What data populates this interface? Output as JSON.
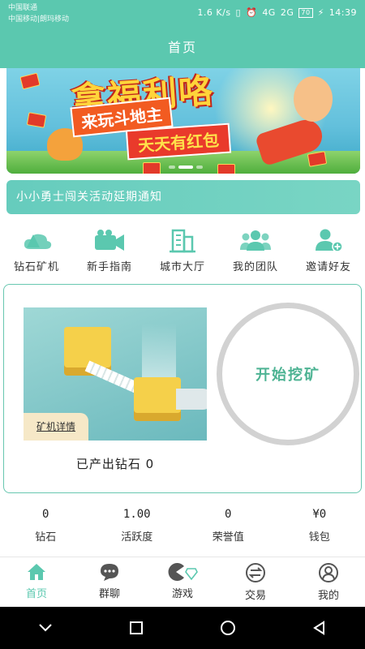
{
  "status_bar": {
    "carrier_line1": "中国联通",
    "carrier_line2": "中国移动|朗玛移动",
    "speed": "1.6 K/s",
    "signal1": "4G",
    "signal2": "2G",
    "battery": "70",
    "time": "14:39"
  },
  "header": {
    "title": "首页"
  },
  "banner": {
    "headline": "拿福利咯",
    "tag1": "来玩斗地主",
    "tag2": "天天有红包",
    "active_slide": 2,
    "slide_count": 3
  },
  "notice": {
    "text": "小小勇士闯关活动延期通知"
  },
  "menu": [
    {
      "label": "钻石矿机",
      "icon": "cloud-icon"
    },
    {
      "label": "新手指南",
      "icon": "video-camera-icon"
    },
    {
      "label": "城市大厅",
      "icon": "building-icon"
    },
    {
      "label": "我的团队",
      "icon": "team-icon"
    },
    {
      "label": "邀请好友",
      "icon": "add-user-icon"
    }
  ],
  "mining": {
    "detail_label": "矿机详情",
    "produced_label": "已产出钻石",
    "produced_value": "0",
    "start_label": "开始挖矿"
  },
  "stats": [
    {
      "value": "0",
      "label": "钻石"
    },
    {
      "value": "1.00",
      "label": "活跃度"
    },
    {
      "value": "0",
      "label": "荣誉值"
    },
    {
      "value": "¥0",
      "label": "钱包"
    }
  ],
  "tabs": [
    {
      "label": "首页",
      "icon": "home-icon",
      "active": true
    },
    {
      "label": "群聊",
      "icon": "chat-icon",
      "active": false
    },
    {
      "label": "游戏",
      "icon": "game-icon",
      "active": false
    },
    {
      "label": "交易",
      "icon": "exchange-icon",
      "active": false
    },
    {
      "label": "我的",
      "icon": "profile-icon",
      "active": false
    }
  ],
  "colors": {
    "accent": "#5bc8af",
    "start_text": "#4db393",
    "ring": "#d2d2d2"
  }
}
